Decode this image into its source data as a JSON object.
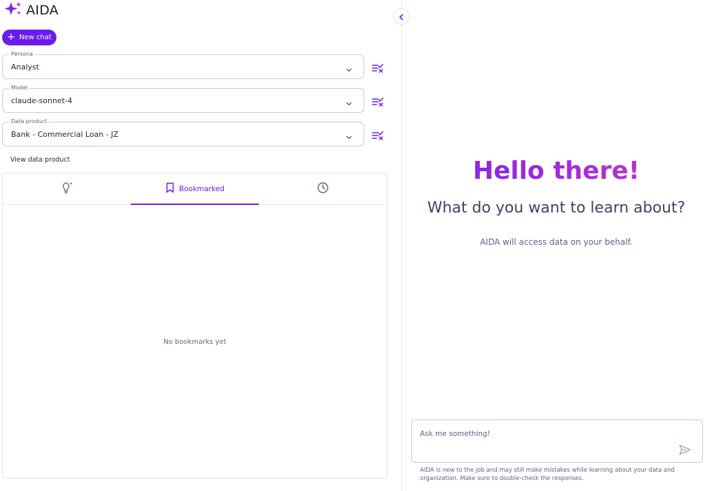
{
  "app": {
    "name": "AIDA"
  },
  "sidebar": {
    "new_chat_label": "New chat",
    "persona": {
      "label": "Persona",
      "value": "Analyst"
    },
    "model": {
      "label": "Model",
      "value": "claude-sonnet-4"
    },
    "data_product": {
      "label": "Data product",
      "value": "Bank - Commercial Loan - JZ"
    },
    "view_data_product_label": "View data product",
    "tabs": [
      {
        "icon": "lightbulb-sparkle-icon",
        "label": ""
      },
      {
        "icon": "bookmark-icon",
        "label": "Bookmarked",
        "active": true
      },
      {
        "icon": "clock-icon",
        "label": ""
      }
    ],
    "empty_message": "No bookmarks yet"
  },
  "main": {
    "greeting": "Hello there!",
    "subheading": "What do you want to learn about?",
    "note": "AIDA will access data on your behalf.",
    "input_placeholder": "Ask me something!",
    "disclaimer": "AIDA is new to the job and may still make mistakes while learning about your data and organization. Make sure to double-check the responses."
  },
  "colors": {
    "accent": "#6a1bf0",
    "gradient_end": "#c43fc0",
    "subheading": "#3c4468"
  }
}
